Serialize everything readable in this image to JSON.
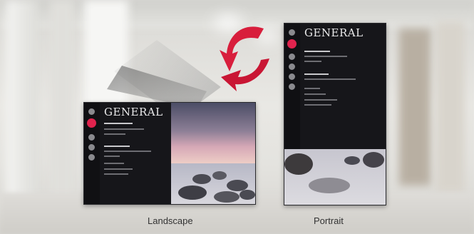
{
  "monitors": {
    "landscape": {
      "menu_title": "GENERAL",
      "caption": "Landscape"
    },
    "portrait": {
      "menu_title": "GENERAL",
      "caption": "Portrait"
    }
  },
  "colors": {
    "accent": "#e0234d",
    "arrow": "#d81e3c"
  },
  "icons": [
    "rotate-arrow-icon",
    "rotate-arrow-icon"
  ]
}
